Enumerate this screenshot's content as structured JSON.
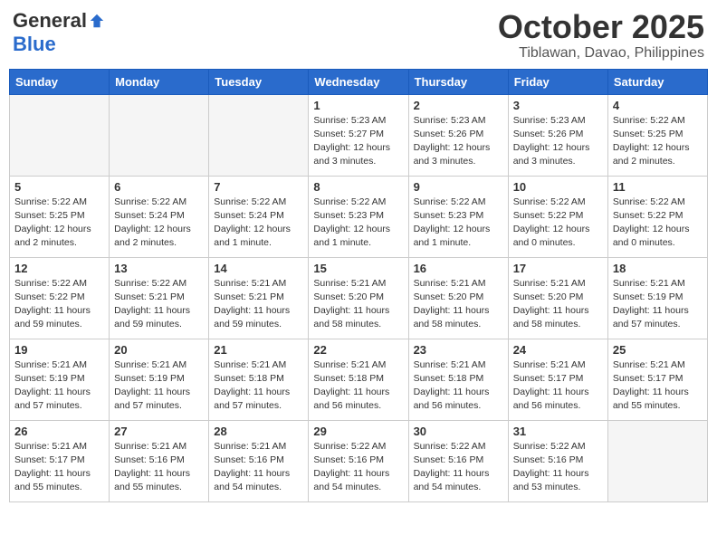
{
  "header": {
    "logo_general": "General",
    "logo_blue": "Blue",
    "month_title": "October 2025",
    "location": "Tiblawan, Davao, Philippines"
  },
  "weekdays": [
    "Sunday",
    "Monday",
    "Tuesday",
    "Wednesday",
    "Thursday",
    "Friday",
    "Saturday"
  ],
  "weeks": [
    [
      {
        "day": "",
        "info": ""
      },
      {
        "day": "",
        "info": ""
      },
      {
        "day": "",
        "info": ""
      },
      {
        "day": "1",
        "info": "Sunrise: 5:23 AM\nSunset: 5:27 PM\nDaylight: 12 hours\nand 3 minutes."
      },
      {
        "day": "2",
        "info": "Sunrise: 5:23 AM\nSunset: 5:26 PM\nDaylight: 12 hours\nand 3 minutes."
      },
      {
        "day": "3",
        "info": "Sunrise: 5:23 AM\nSunset: 5:26 PM\nDaylight: 12 hours\nand 3 minutes."
      },
      {
        "day": "4",
        "info": "Sunrise: 5:22 AM\nSunset: 5:25 PM\nDaylight: 12 hours\nand 2 minutes."
      }
    ],
    [
      {
        "day": "5",
        "info": "Sunrise: 5:22 AM\nSunset: 5:25 PM\nDaylight: 12 hours\nand 2 minutes."
      },
      {
        "day": "6",
        "info": "Sunrise: 5:22 AM\nSunset: 5:24 PM\nDaylight: 12 hours\nand 2 minutes."
      },
      {
        "day": "7",
        "info": "Sunrise: 5:22 AM\nSunset: 5:24 PM\nDaylight: 12 hours\nand 1 minute."
      },
      {
        "day": "8",
        "info": "Sunrise: 5:22 AM\nSunset: 5:23 PM\nDaylight: 12 hours\nand 1 minute."
      },
      {
        "day": "9",
        "info": "Sunrise: 5:22 AM\nSunset: 5:23 PM\nDaylight: 12 hours\nand 1 minute."
      },
      {
        "day": "10",
        "info": "Sunrise: 5:22 AM\nSunset: 5:22 PM\nDaylight: 12 hours\nand 0 minutes."
      },
      {
        "day": "11",
        "info": "Sunrise: 5:22 AM\nSunset: 5:22 PM\nDaylight: 12 hours\nand 0 minutes."
      }
    ],
    [
      {
        "day": "12",
        "info": "Sunrise: 5:22 AM\nSunset: 5:22 PM\nDaylight: 11 hours\nand 59 minutes."
      },
      {
        "day": "13",
        "info": "Sunrise: 5:22 AM\nSunset: 5:21 PM\nDaylight: 11 hours\nand 59 minutes."
      },
      {
        "day": "14",
        "info": "Sunrise: 5:21 AM\nSunset: 5:21 PM\nDaylight: 11 hours\nand 59 minutes."
      },
      {
        "day": "15",
        "info": "Sunrise: 5:21 AM\nSunset: 5:20 PM\nDaylight: 11 hours\nand 58 minutes."
      },
      {
        "day": "16",
        "info": "Sunrise: 5:21 AM\nSunset: 5:20 PM\nDaylight: 11 hours\nand 58 minutes."
      },
      {
        "day": "17",
        "info": "Sunrise: 5:21 AM\nSunset: 5:20 PM\nDaylight: 11 hours\nand 58 minutes."
      },
      {
        "day": "18",
        "info": "Sunrise: 5:21 AM\nSunset: 5:19 PM\nDaylight: 11 hours\nand 57 minutes."
      }
    ],
    [
      {
        "day": "19",
        "info": "Sunrise: 5:21 AM\nSunset: 5:19 PM\nDaylight: 11 hours\nand 57 minutes."
      },
      {
        "day": "20",
        "info": "Sunrise: 5:21 AM\nSunset: 5:19 PM\nDaylight: 11 hours\nand 57 minutes."
      },
      {
        "day": "21",
        "info": "Sunrise: 5:21 AM\nSunset: 5:18 PM\nDaylight: 11 hours\nand 57 minutes."
      },
      {
        "day": "22",
        "info": "Sunrise: 5:21 AM\nSunset: 5:18 PM\nDaylight: 11 hours\nand 56 minutes."
      },
      {
        "day": "23",
        "info": "Sunrise: 5:21 AM\nSunset: 5:18 PM\nDaylight: 11 hours\nand 56 minutes."
      },
      {
        "day": "24",
        "info": "Sunrise: 5:21 AM\nSunset: 5:17 PM\nDaylight: 11 hours\nand 56 minutes."
      },
      {
        "day": "25",
        "info": "Sunrise: 5:21 AM\nSunset: 5:17 PM\nDaylight: 11 hours\nand 55 minutes."
      }
    ],
    [
      {
        "day": "26",
        "info": "Sunrise: 5:21 AM\nSunset: 5:17 PM\nDaylight: 11 hours\nand 55 minutes."
      },
      {
        "day": "27",
        "info": "Sunrise: 5:21 AM\nSunset: 5:16 PM\nDaylight: 11 hours\nand 55 minutes."
      },
      {
        "day": "28",
        "info": "Sunrise: 5:21 AM\nSunset: 5:16 PM\nDaylight: 11 hours\nand 54 minutes."
      },
      {
        "day": "29",
        "info": "Sunrise: 5:22 AM\nSunset: 5:16 PM\nDaylight: 11 hours\nand 54 minutes."
      },
      {
        "day": "30",
        "info": "Sunrise: 5:22 AM\nSunset: 5:16 PM\nDaylight: 11 hours\nand 54 minutes."
      },
      {
        "day": "31",
        "info": "Sunrise: 5:22 AM\nSunset: 5:16 PM\nDaylight: 11 hours\nand 53 minutes."
      },
      {
        "day": "",
        "info": ""
      }
    ]
  ]
}
